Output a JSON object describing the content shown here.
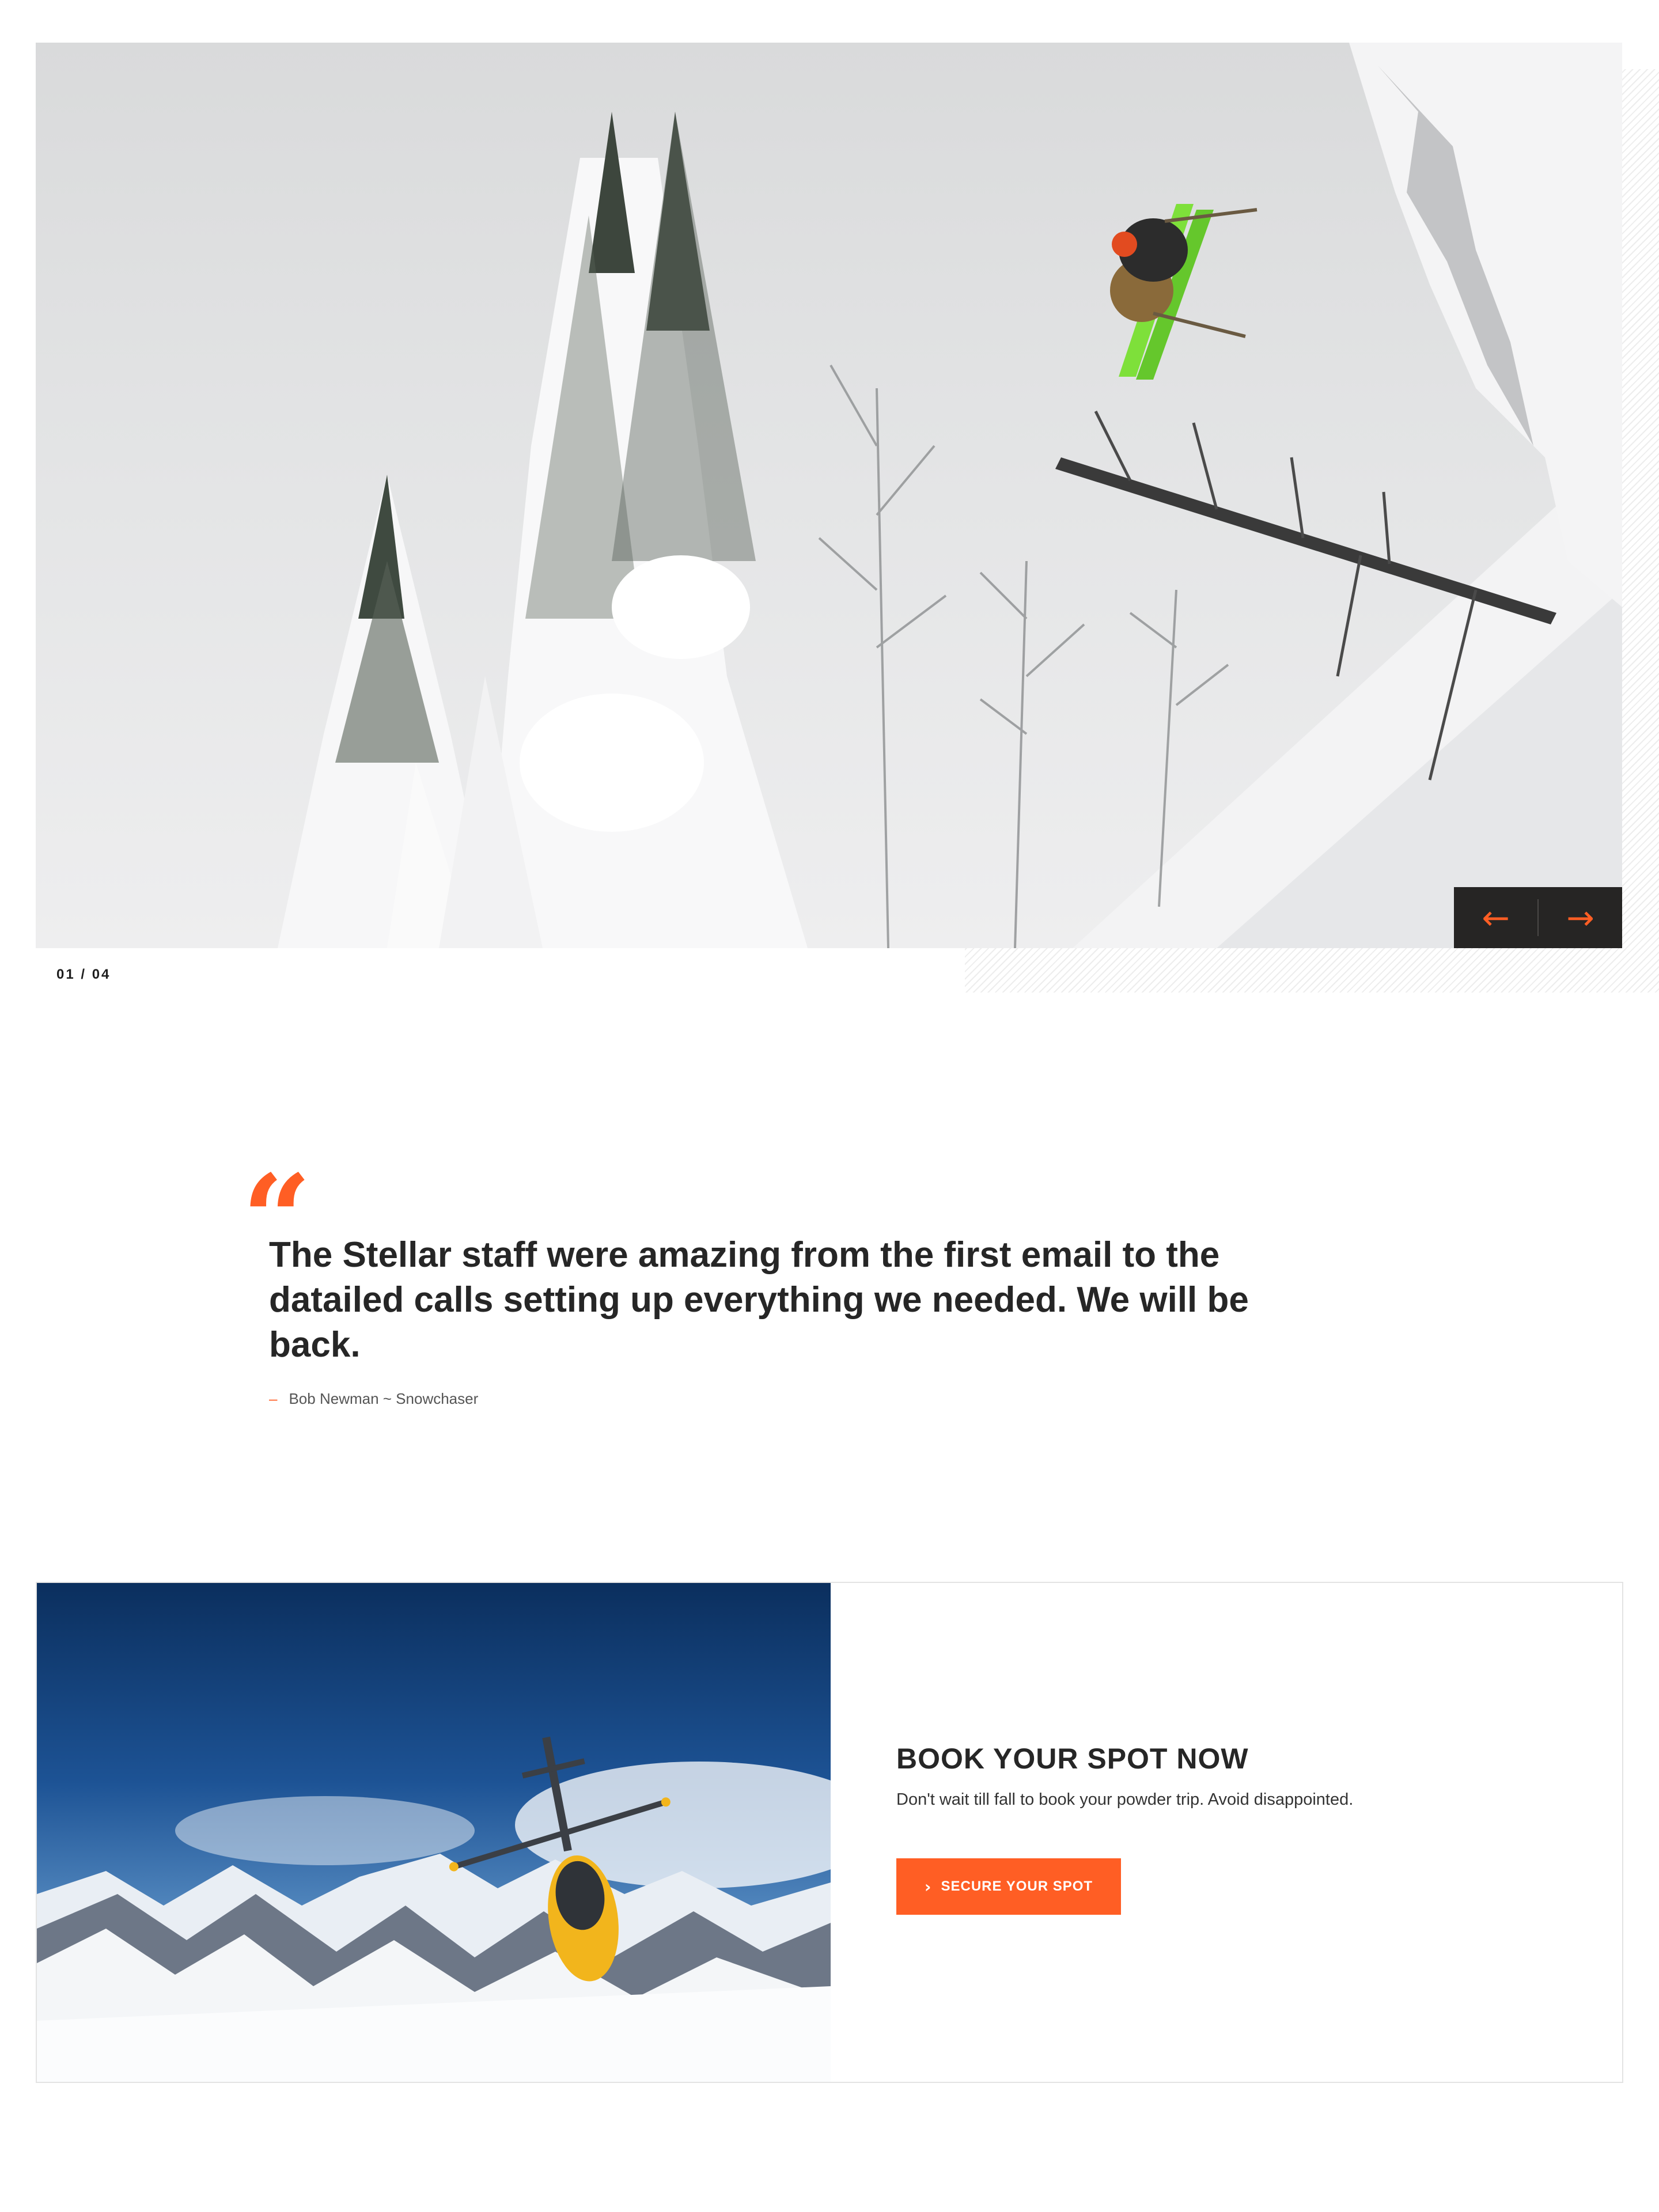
{
  "slider": {
    "counter": "01 / 04",
    "prev_icon": "←",
    "next_icon": "→",
    "hero_image": "skier jumping over snow-covered trees",
    "accent_color": "#ff5e24",
    "dark_color": "#262524"
  },
  "testimonial": {
    "quote_mark": "“",
    "quote": "The Stellar staff were amazing from the first email to the datailed calls setting up everything we needed. We will be back.",
    "dash": "–",
    "author": "Bob Newman ~ Snowchaser"
  },
  "promo": {
    "image": "helicopter landing on snowy mountain peak",
    "title": "BOOK YOUR SPOT NOW",
    "text": "Don't wait till fall to book your powder trip. Avoid disappointed.",
    "cta_icon": "›",
    "cta_label": "SECURE YOUR SPOT"
  }
}
